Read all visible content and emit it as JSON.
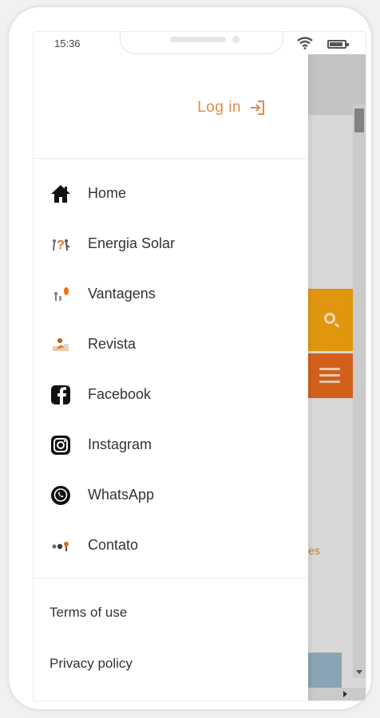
{
  "status": {
    "time": "15:36"
  },
  "drawer": {
    "login_label": "Log in",
    "items": [
      {
        "label": "Home",
        "icon": "home-icon"
      },
      {
        "label": "Energia Solar",
        "icon": "solar-energy-icon"
      },
      {
        "label": "Vantagens",
        "icon": "advantages-icon"
      },
      {
        "label": "Revista",
        "icon": "magazine-icon"
      },
      {
        "label": "Facebook",
        "icon": "facebook-icon"
      },
      {
        "label": "Instagram",
        "icon": "instagram-icon"
      },
      {
        "label": "WhatsApp",
        "icon": "whatsapp-icon"
      },
      {
        "label": "Contato",
        "icon": "contact-icon"
      }
    ],
    "footer": {
      "terms_label": "Terms of use",
      "privacy_label": "Privacy policy"
    }
  },
  "background": {
    "partial_text": "es"
  },
  "colors": {
    "accent": "#e08a4a",
    "search_bg": "#f0a010",
    "menu_bg": "#e0661c"
  }
}
